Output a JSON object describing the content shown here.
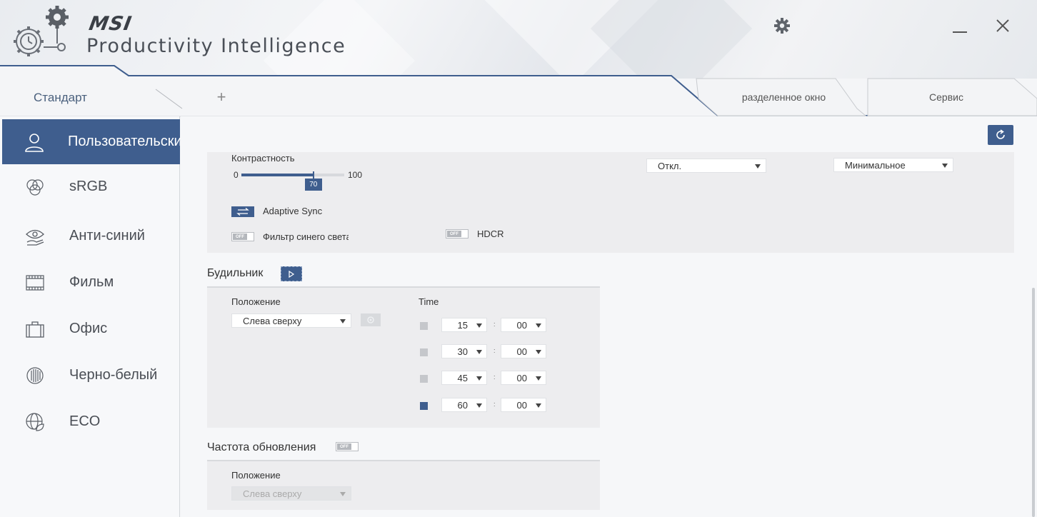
{
  "app": {
    "brand": "MSI",
    "title": "Productivity Intelligence"
  },
  "window": {
    "settings_icon": "gear-icon",
    "minimize_icon": "minimize-icon",
    "close_icon": "close-icon"
  },
  "tabs": {
    "standard": "Стандарт",
    "add": "+",
    "split": "разделенное окно",
    "service": "Сервис"
  },
  "sidebar": {
    "items": [
      {
        "label": "Пользовательский",
        "icon": "user-icon",
        "active": true
      },
      {
        "label": "sRGB",
        "icon": "color-circles-icon",
        "active": false
      },
      {
        "label": "Анти-синий",
        "icon": "eye-hand-icon",
        "active": false
      },
      {
        "label": "Фильм",
        "icon": "film-icon",
        "active": false
      },
      {
        "label": "Офис",
        "icon": "briefcase-icon",
        "active": false
      },
      {
        "label": "Черно-белый",
        "icon": "bw-circle-icon",
        "active": false
      },
      {
        "label": "ECO",
        "icon": "eco-globe-icon",
        "active": false
      }
    ]
  },
  "display": {
    "contrast_label": "Контрастность",
    "contrast_min": "0",
    "contrast_max": "100",
    "contrast_value": "70",
    "contrast_fraction": 0.7,
    "dropdown_1": "Откл.",
    "dropdown_2": "Минимальное",
    "adaptive_sync_label": "Adaptive Sync",
    "adaptive_sync_on": true,
    "blue_filter_label": "Фильтр синего света",
    "blue_filter_toggle": "OFF",
    "hdcr_label": "HDCR",
    "hdcr_toggle": "OFF"
  },
  "alarm": {
    "title": "Будильник",
    "position_label": "Положение",
    "position_value": "Слева сверху",
    "time_label": "Time",
    "colon": ":",
    "rows": [
      {
        "checked": false,
        "minutes": "15",
        "seconds": "00"
      },
      {
        "checked": false,
        "minutes": "30",
        "seconds": "00"
      },
      {
        "checked": false,
        "minutes": "45",
        "seconds": "00"
      },
      {
        "checked": true,
        "minutes": "60",
        "seconds": "00"
      }
    ]
  },
  "refresh": {
    "title": "Частота обновления",
    "toggle": "OFF",
    "position_label": "Положение",
    "position_value": "Слева сверху"
  },
  "colors": {
    "accent": "#3f5e8e",
    "sidebar_bg": "#f7f8fa",
    "panel_bg": "#ededef"
  }
}
